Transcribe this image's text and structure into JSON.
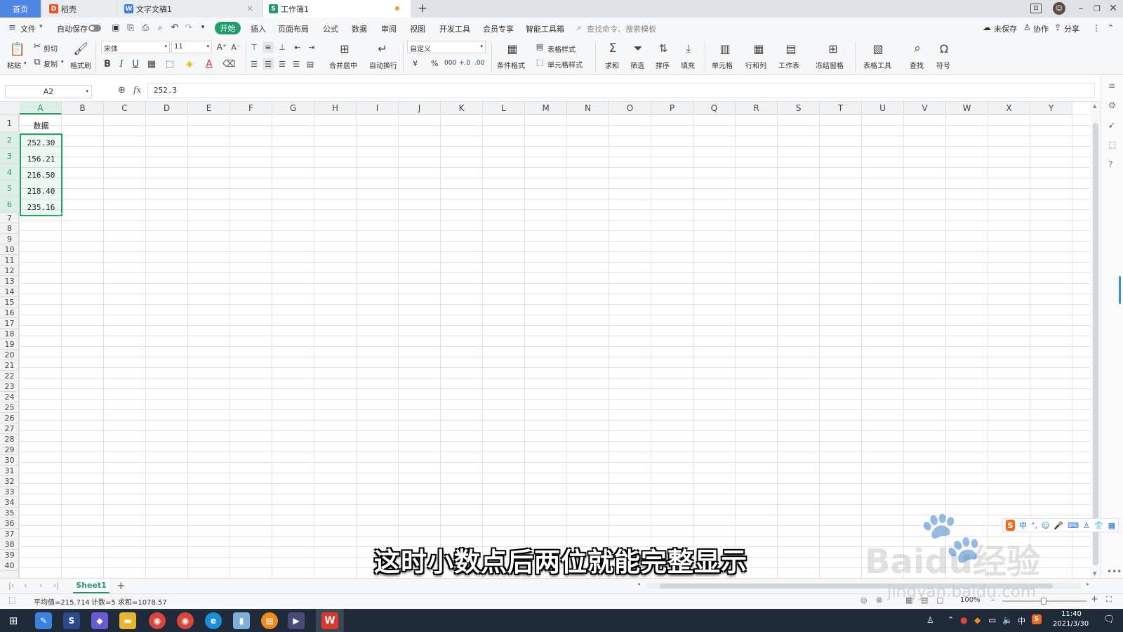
{
  "tabs": [
    {
      "label": "首页",
      "active": true
    },
    {
      "label": "稻壳",
      "icon": "docer-icon"
    },
    {
      "label": "文字文稿1",
      "icon": "writer-icon"
    },
    {
      "label": "工作簿1",
      "icon": "sheet-icon",
      "current": true
    }
  ],
  "menu": {
    "file": "文件",
    "autosave": "自动保存",
    "start": "开始",
    "items": [
      "插入",
      "页面布局",
      "公式",
      "数据",
      "审阅",
      "视图",
      "开发工具",
      "会员专享",
      "智能工具箱"
    ],
    "search_placeholder": "查找命令、搜索模板",
    "unsaved": "未保存",
    "collab": "协作",
    "share": "分享"
  },
  "ribbon": {
    "paste": "粘贴",
    "cut": "剪切",
    "copy": "复制",
    "format_painter": "格式刷",
    "font": "宋体",
    "size": "11",
    "merge": "合并居中",
    "wrap": "自动换行",
    "number_format": "自定义",
    "cond_format": "条件格式",
    "table_style": "表格样式",
    "cell_style": "单元格样式",
    "sum": "求和",
    "filter": "筛选",
    "sort": "排序",
    "fill": "填充",
    "cells": "单元格",
    "rowcol": "行和列",
    "worksheet": "工作表",
    "freeze": "冻结窗格",
    "tools": "表格工具",
    "find": "查找",
    "symbol": "符号",
    "currency": "¥",
    "percent": "%",
    "thousand": "000",
    "inc_decimal": "+.0",
    "dec_decimal": ".00"
  },
  "formula_bar": {
    "name_box": "A2",
    "fx": "fx",
    "value": "252.3"
  },
  "columns": [
    "A",
    "B",
    "C",
    "D",
    "E",
    "F",
    "G",
    "H",
    "I",
    "J",
    "K",
    "L",
    "M",
    "N",
    "O",
    "P",
    "Q",
    "R",
    "S",
    "T",
    "U",
    "V",
    "W",
    "X",
    "Y"
  ],
  "rows": [
    "1",
    "2",
    "3",
    "4",
    "5",
    "6",
    "7",
    "8",
    "9",
    "10",
    "11",
    "12",
    "13",
    "14",
    "15",
    "16",
    "17",
    "18",
    "19",
    "20",
    "21",
    "22",
    "23",
    "24",
    "25",
    "26",
    "27",
    "28",
    "29",
    "30",
    "31",
    "32",
    "33",
    "34",
    "35",
    "36",
    "37",
    "38",
    "39",
    "40"
  ],
  "cells": {
    "A1": "数据",
    "A2": "252.30",
    "A3": "156.21",
    "A4": "216.50",
    "A5": "218.40",
    "A6": "235.16"
  },
  "sheet": {
    "name": "Sheet1",
    "add": "+"
  },
  "status": {
    "avg": "平均值=215.714",
    "count": "计数=5",
    "sum": "求和=1078.57",
    "zoom": "100%"
  },
  "subtitle": "这时小数点后两位就能完整显示",
  "watermark": {
    "logo": "Baidu经验",
    "url": "jingyan.baidu.com"
  },
  "ime": {
    "label": "中"
  },
  "taskbar": {
    "lang": "中",
    "time": "11:40",
    "date": "2021/3/30"
  },
  "colors": {
    "accent": "#1f9c6c",
    "selection": "#21a366",
    "tab_active": "#4f86e6",
    "taskbar": "#1f2a3a"
  }
}
